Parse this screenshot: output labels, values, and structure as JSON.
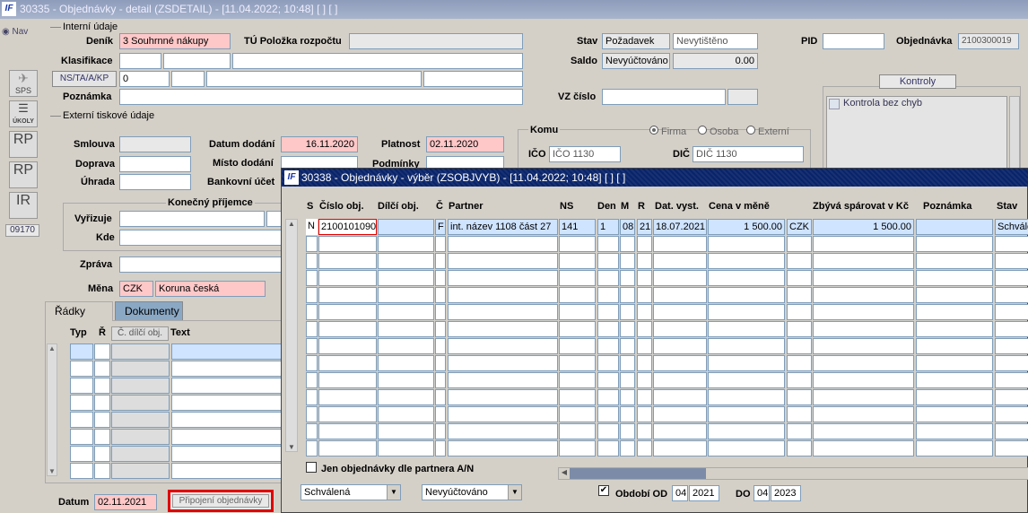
{
  "window": {
    "title": "30335 - Objednávky - detail (ZSDETAIL) - [11.04.2022; 10:48]  [ ]  [ ]",
    "logo": "IF"
  },
  "side": {
    "nav": "Nav",
    "sps": "SPS",
    "ukoly": "ÚKOLY",
    "rp1": "RP",
    "rp2": "RP",
    "ir": "IR",
    "code": "09170"
  },
  "interni": {
    "section": "Interní údaje",
    "denik_label": "Deník",
    "denik_value": "3 Souhrnné nákupy",
    "tu_label": "TÚ Položka rozpočtu",
    "tu_value": "",
    "stav_label": "Stav",
    "stav_value": "Požadavek",
    "stav_tisk": "Nevytištěno",
    "pid_label": "PID",
    "pid_value": "",
    "objednavka_label": "Objednávka",
    "objednavka_value": "2100300019",
    "klasifikace_label": "Klasifikace",
    "saldo_label": "Saldo",
    "saldo_value": "Nevyúčtováno",
    "saldo_amount": "0.00",
    "nstaakp_label": "NS/TA/A/KP",
    "nstaakp_value": "0",
    "poznamka_label": "Poznámka",
    "vz_label": "VZ číslo"
  },
  "kontroly": {
    "title": "Kontroly",
    "item": "Kontrola bez chyb"
  },
  "externi": {
    "section": "Externí tiskové údaje",
    "smlouva_label": "Smlouva",
    "datum_dodani_label": "Datum dodání",
    "datum_dodani_value": "16.11.2020",
    "platnost_label": "Platnost",
    "platnost_value": "02.11.2020",
    "doprava_label": "Doprava",
    "misto_dodani_label": "Místo dodání",
    "podminky_label": "Podmínky",
    "uhrada_label": "Úhrada",
    "bankovni_label": "Bankovní účet",
    "komu_label": "Komu",
    "radio_firma": "Firma",
    "radio_osoba": "Osoba",
    "radio_externi": "Externí",
    "ico_label": "IČO",
    "ico_value": "IČO 1130",
    "dic_label": "DIČ",
    "dic_value": "DIČ 1130",
    "konecny_label": "Konečný příjemce",
    "vyrizuje_label": "Vyřizuje",
    "kde_label": "Kde",
    "zprava_label": "Zpráva",
    "mena_label": "Měna",
    "mena_code": "CZK",
    "mena_name": "Koruna česká"
  },
  "tabs": {
    "radky": "Řádky",
    "dokumenty": "Dokumenty"
  },
  "lines": {
    "col_typ": "Typ",
    "col_r": "Ř",
    "col_dilci": "Č. dílčí obj.",
    "col_text": "Text"
  },
  "footer": {
    "datum_label": "Datum",
    "datum_value": "02.11.2021",
    "pripojeni_button": "Připojení objednávky"
  },
  "modal": {
    "title": "30338 - Objednávky - výběr (ZSOBJVYB) - [11.04.2022; 10:48]  [ ]  [ ]",
    "logo": "IF",
    "headers": {
      "s": "S",
      "cislo": "Číslo obj.",
      "dilci": "Dílčí obj.",
      "c": "Č",
      "partner": "Partner",
      "ns": "NS",
      "den": "Den",
      "m": "M",
      "r": "R",
      "dat": "Dat. vyst.",
      "cena": "Cena v měně",
      "zbyva": "Zbývá spárovat v Kč",
      "poznamka": "Poznámka",
      "stav": "Stav"
    },
    "row": {
      "s": "N",
      "cislo": "2100101090",
      "dilci": "",
      "c": "F",
      "partner": "int. název 1108 část 27",
      "ns": "141",
      "den": "1",
      "m": "08",
      "r": "21",
      "dat": "18.07.2021",
      "cena": "1 500.00",
      "mena": "CZK",
      "zbyva": "1 500.00",
      "poznamka": "",
      "stav": "Schválená"
    },
    "checkbox_label": "Jen objednávky dle partnera A/N",
    "filter_stav": "Schválená",
    "filter_saldo": "Nevyúčtováno",
    "obdobi_label": "Období OD",
    "od_month": "04",
    "od_year": "2021",
    "do_label": "DO",
    "do_month": "04",
    "do_year": "2023"
  }
}
